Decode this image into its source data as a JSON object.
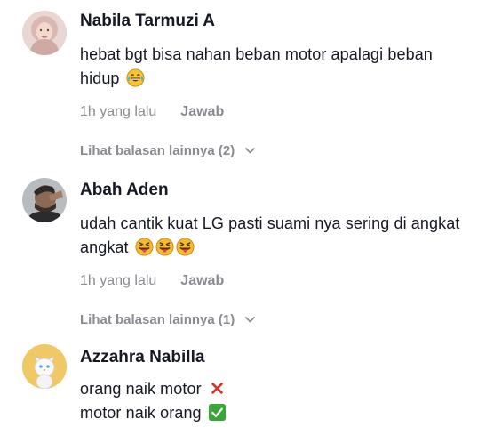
{
  "comments": [
    {
      "author": "Nabila Tarmuzi A",
      "text_line1": "hebat bgt bisa nahan beban motor apalagi beban",
      "text_line2": "hidup",
      "emojis": [
        "laughing-tears-emoji"
      ],
      "time": "1h yang lalu",
      "reply_label": "Jawab",
      "more_replies": "Lihat balasan lainnya (2)",
      "avatar": "avatar-hijab-woman"
    },
    {
      "author": "Abah Aden",
      "text_line1": "udah cantik kuat LG pasti suami nya sering di angkat",
      "text_line2": "angkat",
      "emojis": [
        "tongue-wink-emoji",
        "tongue-wink-emoji",
        "tongue-wink-emoji"
      ],
      "time": "1h yang lalu",
      "reply_label": "Jawab",
      "more_replies": "Lihat balasan lainnya (1)",
      "avatar": "avatar-man-selfie"
    },
    {
      "author": "Azzahra Nabilla",
      "text_line1": "orang naik motor",
      "text_line2": "motor naik orang",
      "emojis": [
        "red-cross-mark-emoji",
        "green-check-mark-emoji"
      ],
      "avatar": "avatar-white-cat"
    }
  ],
  "colors": {
    "primary_text": "#161823",
    "secondary_text": "#8a8b91",
    "cross_red": "#d9302a",
    "check_green": "#3aa53a"
  }
}
